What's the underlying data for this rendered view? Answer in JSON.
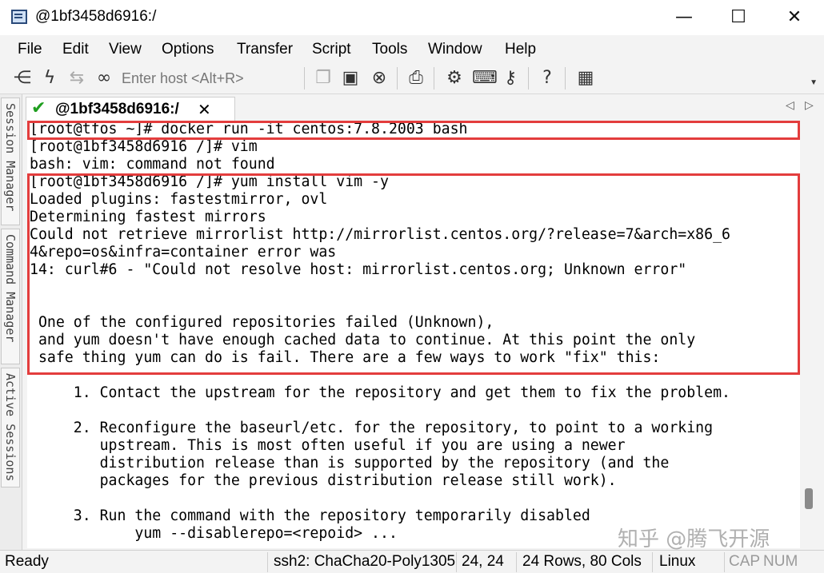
{
  "window": {
    "title": "@1bf3458d6916:/",
    "controls": {
      "minimize": "—",
      "maximize": "☐",
      "close": "✕"
    }
  },
  "menu": [
    "File",
    "Edit",
    "View",
    "Options",
    "Transfer",
    "Script",
    "Tools",
    "Window",
    "Help"
  ],
  "toolbar": {
    "host_placeholder": "Enter host <Alt+R>",
    "icons": {
      "connect": "connect-icon",
      "quick_connect": "lightning-icon",
      "reconnect": "reconnect-icon",
      "disconnect": "disconnect-icon",
      "copy": "copy-icon",
      "paste": "paste-icon",
      "find": "binoculars-icon",
      "print": "printer-icon",
      "session_options": "gear-icon",
      "keymap": "keyboard-icon",
      "key_agent": "key-icon",
      "help": "help-icon",
      "sftp": "sftp-icon"
    }
  },
  "side_panel": {
    "tabs": [
      "Session Manager",
      "Command Manager",
      "Active Sessions"
    ]
  },
  "tab": {
    "label": "@1bf3458d6916:/",
    "status_icon": "check-icon",
    "close": "✕",
    "nav_prev": "◁",
    "nav_next": "▷"
  },
  "terminal": {
    "lines": [
      "[root@tfos ~]# docker run -it centos:7.8.2003 bash",
      "[root@1bf3458d6916 /]# vim",
      "bash: vim: command not found",
      "[root@1bf3458d6916 /]# yum install vim -y",
      "Loaded plugins: fastestmirror, ovl",
      "Determining fastest mirrors",
      "Could not retrieve mirrorlist http://mirrorlist.centos.org/?release=7&arch=x86_6",
      "4&repo=os&infra=container error was",
      "14: curl#6 - \"Could not resolve host: mirrorlist.centos.org; Unknown error\"",
      "",
      "",
      " One of the configured repositories failed (Unknown),",
      " and yum doesn't have enough cached data to continue. At this point the only",
      " safe thing yum can do is fail. There are a few ways to work \"fix\" this:",
      "",
      "     1. Contact the upstream for the repository and get them to fix the problem.",
      "",
      "     2. Reconfigure the baseurl/etc. for the repository, to point to a working",
      "        upstream. This is most often useful if you are using a newer",
      "        distribution release than is supported by the repository (and the",
      "        packages for the previous distribution release still work).",
      "",
      "     3. Run the command with the repository temporarily disabled",
      "            yum --disablerepo=<repoid> ..."
    ],
    "highlight_color": "#e33d3d"
  },
  "watermark": "知乎 @腾飞开源",
  "status": {
    "ready": "Ready",
    "cipher": "ssh2: ChaCha20-Poly1305",
    "cursor": "24,  24",
    "size": "24 Rows, 80 Cols",
    "os": "Linux",
    "caps": "CAP",
    "num": "NUM"
  }
}
